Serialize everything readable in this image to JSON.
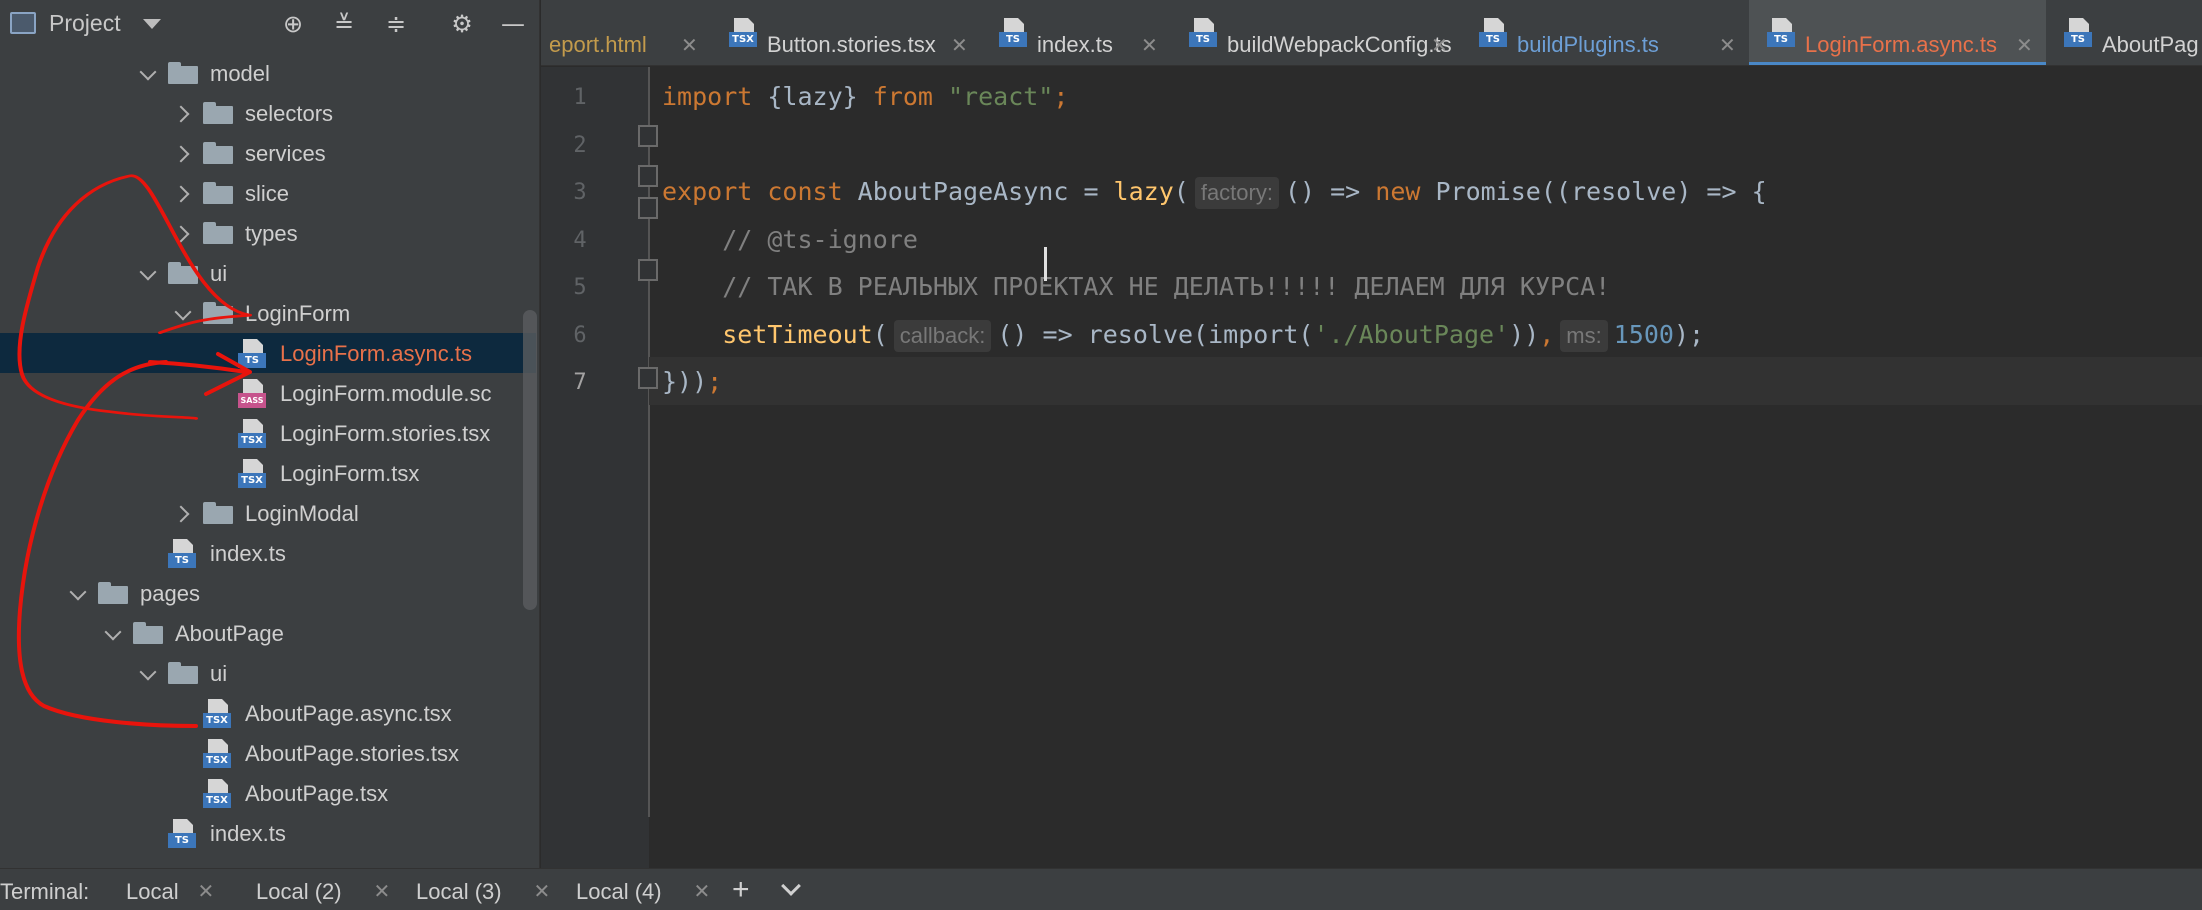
{
  "project_panel": {
    "title": "Project",
    "tree": [
      {
        "label": "model",
        "kind": "folder",
        "expanded": true,
        "depth": 4
      },
      {
        "label": "selectors",
        "kind": "folder",
        "expanded": false,
        "depth": 5
      },
      {
        "label": "services",
        "kind": "folder",
        "expanded": false,
        "depth": 5
      },
      {
        "label": "slice",
        "kind": "folder",
        "expanded": false,
        "depth": 5
      },
      {
        "label": "types",
        "kind": "folder",
        "expanded": false,
        "depth": 5
      },
      {
        "label": "ui",
        "kind": "folder",
        "expanded": true,
        "depth": 4
      },
      {
        "label": "LoginForm",
        "kind": "folder",
        "expanded": true,
        "depth": 5
      },
      {
        "label": "LoginForm.async.ts",
        "kind": "file",
        "badge": "TS",
        "type": "ts",
        "depth": 6,
        "selected": true
      },
      {
        "label": "LoginForm.module.sc",
        "kind": "file",
        "badge": "SASS",
        "type": "sass",
        "depth": 6
      },
      {
        "label": "LoginForm.stories.tsx",
        "kind": "file",
        "badge": "TSX",
        "type": "tsx",
        "depth": 6
      },
      {
        "label": "LoginForm.tsx",
        "kind": "file",
        "badge": "TSX",
        "type": "tsx",
        "depth": 6
      },
      {
        "label": "LoginModal",
        "kind": "folder",
        "expanded": false,
        "depth": 5
      },
      {
        "label": "index.ts",
        "kind": "file",
        "badge": "TS",
        "type": "ts",
        "depth": 4
      },
      {
        "label": "pages",
        "kind": "folder",
        "expanded": true,
        "depth": 2
      },
      {
        "label": "AboutPage",
        "kind": "folder",
        "expanded": true,
        "depth": 3
      },
      {
        "label": "ui",
        "kind": "folder",
        "expanded": true,
        "depth": 4
      },
      {
        "label": "AboutPage.async.tsx",
        "kind": "file",
        "badge": "TSX",
        "type": "tsx",
        "depth": 5
      },
      {
        "label": "AboutPage.stories.tsx",
        "kind": "file",
        "badge": "TSX",
        "type": "tsx",
        "depth": 5
      },
      {
        "label": "AboutPage.tsx",
        "kind": "file",
        "badge": "TSX",
        "type": "tsx",
        "depth": 5
      },
      {
        "label": "index.ts",
        "kind": "file",
        "badge": "TS",
        "type": "ts",
        "depth": 4
      }
    ]
  },
  "tabs": [
    {
      "label": "eport.html",
      "badge": "",
      "type": "html",
      "color": "#c39b4c"
    },
    {
      "label": "Button.stories.tsx",
      "badge": "TSX",
      "type": "tsx",
      "color": "#d2d2d2"
    },
    {
      "label": "index.ts",
      "badge": "TS",
      "type": "ts",
      "color": "#d2d2d2"
    },
    {
      "label": "buildWebpackConfig.ts",
      "badge": "TS",
      "type": "ts",
      "color": "#d2d2d2"
    },
    {
      "label": "buildPlugins.ts",
      "badge": "TS",
      "type": "ts",
      "color": "#6d9fd6"
    },
    {
      "label": "LoginForm.async.ts",
      "badge": "TS",
      "type": "ts",
      "color": "#e8714a",
      "active": true
    },
    {
      "label": "AboutPag",
      "badge": "TS",
      "type": "ts",
      "color": "#d2d2d2"
    }
  ],
  "editor": {
    "current_line": 7,
    "lines": [
      {
        "n": "1",
        "tokens": [
          [
            "kw",
            "import "
          ],
          [
            "",
            "{lazy} "
          ],
          [
            "kw",
            "from "
          ],
          [
            "str",
            "\"react\""
          ],
          [
            "kw",
            ";"
          ]
        ]
      },
      {
        "n": "2",
        "tokens": []
      },
      {
        "n": "3",
        "tokens": [
          [
            "kw",
            "export const "
          ],
          [
            "",
            "AboutPageAsync = "
          ],
          [
            "fn",
            "lazy"
          ],
          [
            "",
            "("
          ],
          [
            "hint",
            "factory:"
          ],
          [
            "",
            "() => "
          ],
          [
            "kw",
            "new "
          ],
          [
            "",
            "Promise((resolve) => {"
          ]
        ]
      },
      {
        "n": "4",
        "tokens": [
          [
            "cmt",
            "    // @ts-ignore"
          ]
        ]
      },
      {
        "n": "5",
        "tokens": [
          [
            "cmt",
            "    // ТАК В РЕАЛЬНЫХ ПРОЕКТАХ НЕ ДЕЛАТЬ!!!!! ДЕЛАЕМ ДЛЯ КУРСА!"
          ]
        ]
      },
      {
        "n": "6",
        "tokens": [
          [
            "fn",
            "    setTimeout"
          ],
          [
            "",
            "("
          ],
          [
            "hint",
            "callback:"
          ],
          [
            "",
            "() => resolve(import("
          ],
          [
            "str",
            "'./AboutPage'"
          ],
          [
            "",
            "))"
          ],
          [
            "kw",
            ","
          ],
          [
            "hint",
            "ms:"
          ],
          [
            "num",
            "1500"
          ],
          [
            "",
            "); "
          ]
        ]
      },
      {
        "n": "7",
        "tokens": [
          [
            "",
            "}))"
          ],
          [
            "kw",
            ";"
          ]
        ]
      }
    ]
  },
  "terminal": {
    "title": "Terminal:",
    "tabs": [
      "Local",
      "Local (2)",
      "Local (3)",
      "Local (4)"
    ],
    "add_label": "+"
  },
  "icons": {
    "locate": "crosshair-icon",
    "expand": "expand-all-icon",
    "collapse": "collapse-all-icon",
    "settings": "gear-icon",
    "hide": "minimize-icon"
  }
}
